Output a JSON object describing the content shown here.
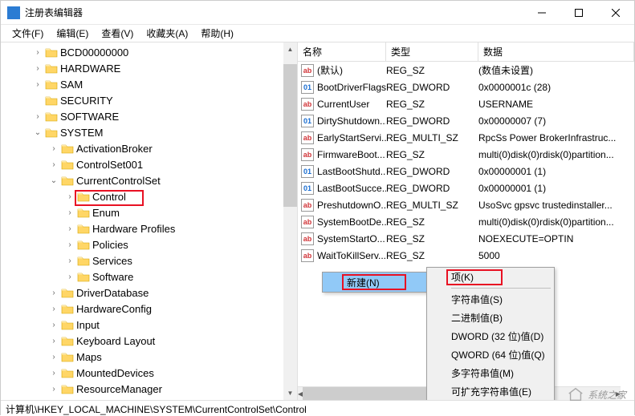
{
  "window": {
    "title": "注册表编辑器"
  },
  "menu": {
    "file": "文件(F)",
    "edit": "编辑(E)",
    "view": "查看(V)",
    "favorites": "收藏夹(A)",
    "help": "帮助(H)"
  },
  "tree": [
    {
      "indent": 40,
      "exp": "›",
      "label": "BCD00000000"
    },
    {
      "indent": 40,
      "exp": "›",
      "label": "HARDWARE"
    },
    {
      "indent": 40,
      "exp": "›",
      "label": "SAM"
    },
    {
      "indent": 40,
      "exp": "",
      "label": "SECURITY"
    },
    {
      "indent": 40,
      "exp": "›",
      "label": "SOFTWARE"
    },
    {
      "indent": 40,
      "exp": "⌄",
      "label": "SYSTEM"
    },
    {
      "indent": 60,
      "exp": "›",
      "label": "ActivationBroker"
    },
    {
      "indent": 60,
      "exp": "›",
      "label": "ControlSet001"
    },
    {
      "indent": 60,
      "exp": "⌄",
      "label": "CurrentControlSet"
    },
    {
      "indent": 80,
      "exp": "›",
      "label": "Control"
    },
    {
      "indent": 80,
      "exp": "›",
      "label": "Enum"
    },
    {
      "indent": 80,
      "exp": "›",
      "label": "Hardware Profiles"
    },
    {
      "indent": 80,
      "exp": "›",
      "label": "Policies"
    },
    {
      "indent": 80,
      "exp": "›",
      "label": "Services"
    },
    {
      "indent": 80,
      "exp": "›",
      "label": "Software"
    },
    {
      "indent": 60,
      "exp": "›",
      "label": "DriverDatabase"
    },
    {
      "indent": 60,
      "exp": "›",
      "label": "HardwareConfig"
    },
    {
      "indent": 60,
      "exp": "›",
      "label": "Input"
    },
    {
      "indent": 60,
      "exp": "›",
      "label": "Keyboard Layout"
    },
    {
      "indent": 60,
      "exp": "›",
      "label": "Maps"
    },
    {
      "indent": 60,
      "exp": "›",
      "label": "MountedDevices"
    },
    {
      "indent": 60,
      "exp": "›",
      "label": "ResourceManager"
    }
  ],
  "columns": {
    "name": "名称",
    "type": "类型",
    "data": "数据"
  },
  "values": [
    {
      "icon": "ab",
      "name": "(默认)",
      "type": "REG_SZ",
      "data": "(数值未设置)"
    },
    {
      "icon": "bin",
      "name": "BootDriverFlags",
      "type": "REG_DWORD",
      "data": "0x0000001c (28)"
    },
    {
      "icon": "ab",
      "name": "CurrentUser",
      "type": "REG_SZ",
      "data": "USERNAME"
    },
    {
      "icon": "bin",
      "name": "DirtyShutdown...",
      "type": "REG_DWORD",
      "data": "0x00000007 (7)"
    },
    {
      "icon": "ab",
      "name": "EarlyStartServi...",
      "type": "REG_MULTI_SZ",
      "data": "RpcSs Power BrokerInfrastruc..."
    },
    {
      "icon": "ab",
      "name": "FirmwareBoot...",
      "type": "REG_SZ",
      "data": "multi(0)disk(0)rdisk(0)partition..."
    },
    {
      "icon": "bin",
      "name": "LastBootShutd...",
      "type": "REG_DWORD",
      "data": "0x00000001 (1)"
    },
    {
      "icon": "bin",
      "name": "LastBootSucce...",
      "type": "REG_DWORD",
      "data": "0x00000001 (1)"
    },
    {
      "icon": "ab",
      "name": "PreshutdownO...",
      "type": "REG_MULTI_SZ",
      "data": "UsoSvc gpsvc trustedinstaller..."
    },
    {
      "icon": "ab",
      "name": "SystemBootDe...",
      "type": "REG_SZ",
      "data": "multi(0)disk(0)rdisk(0)partition..."
    },
    {
      "icon": "ab",
      "name": "SystemStartO...",
      "type": "REG_SZ",
      "data": " NOEXECUTE=OPTIN"
    },
    {
      "icon": "ab",
      "name": "WaitToKillServ...",
      "type": "REG_SZ",
      "data": "5000"
    }
  ],
  "context": {
    "new": "新建(N)",
    "submenu": {
      "key": "项(K)",
      "string": "字符串值(S)",
      "binary": "二进制值(B)",
      "dword": "DWORD (32 位)值(D)",
      "qword": "QWORD (64 位)值(Q)",
      "multi": "多字符串值(M)",
      "expand": "可扩充字符串值(E)"
    }
  },
  "statusbar": "计算机\\HKEY_LOCAL_MACHINE\\SYSTEM\\CurrentControlSet\\Control",
  "watermark": "系统之家"
}
